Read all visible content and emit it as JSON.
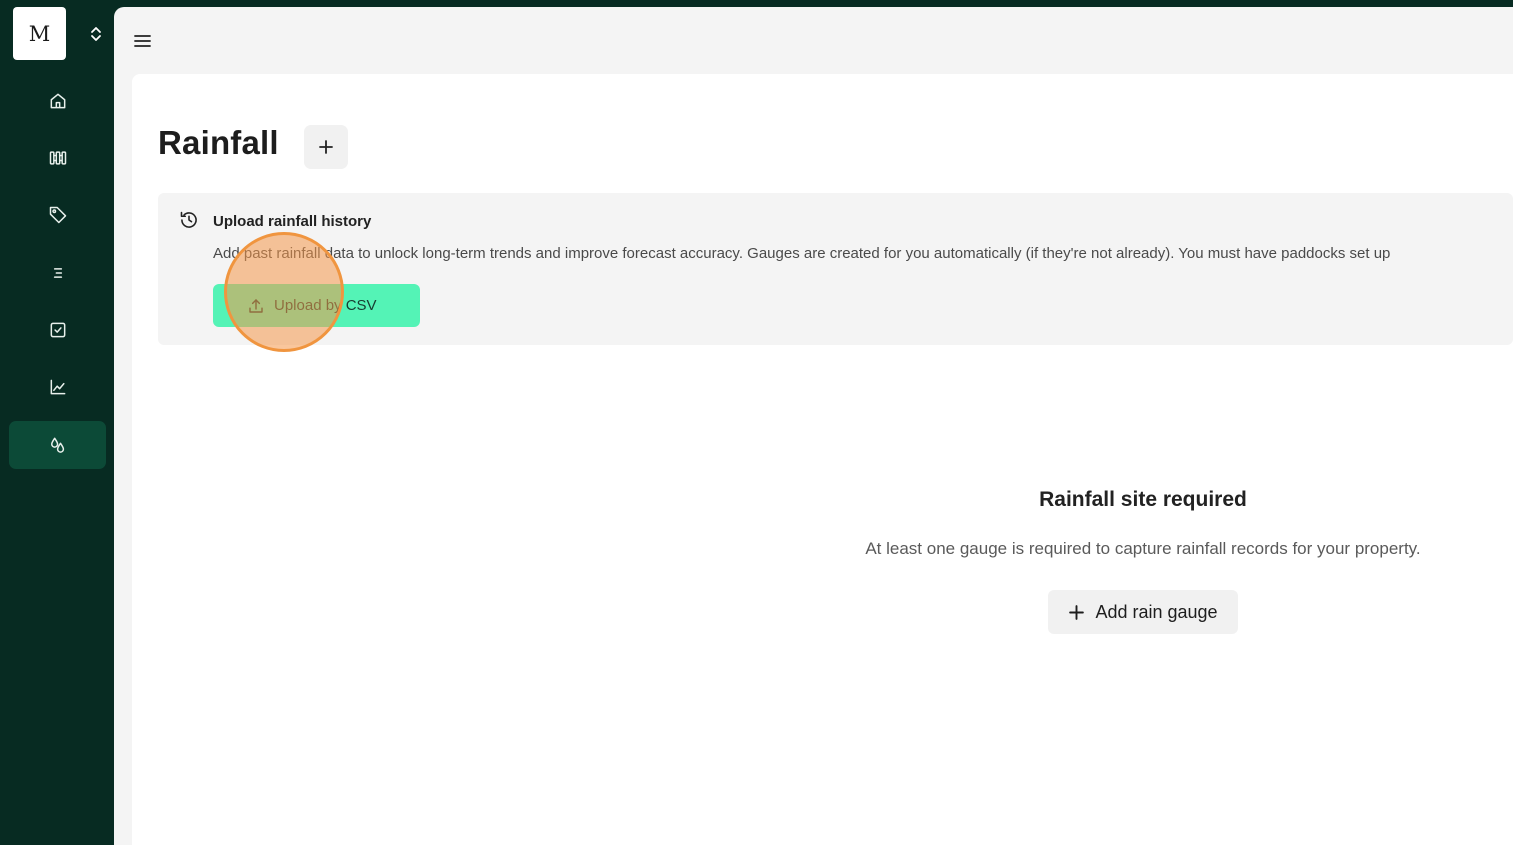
{
  "sidebar": {
    "logo_letter": "M",
    "items": [
      {
        "icon": "home-icon"
      },
      {
        "icon": "fence-icon"
      },
      {
        "icon": "tag-icon"
      },
      {
        "icon": "list-icon"
      },
      {
        "icon": "check-square-icon"
      },
      {
        "icon": "chart-line-icon"
      },
      {
        "icon": "rain-drops-icon",
        "active": true
      }
    ],
    "active_color": "#0c4a37",
    "background_color": "#072b22"
  },
  "page": {
    "title": "Rainfall"
  },
  "banner": {
    "title": "Upload rainfall history",
    "text": "Add past rainfall data to unlock long-term trends and improve forecast accuracy. Gauges are created for you automatically (if they're not already). You must have paddocks set up",
    "button_label": "Upload by CSV",
    "button_color": "#54f3b6"
  },
  "empty_state": {
    "title": "Rainfall site required",
    "text": "At least one gauge is required to capture rainfall records for your property.",
    "button_label": "Add rain gauge"
  },
  "click_marker_color": "#f0953f"
}
